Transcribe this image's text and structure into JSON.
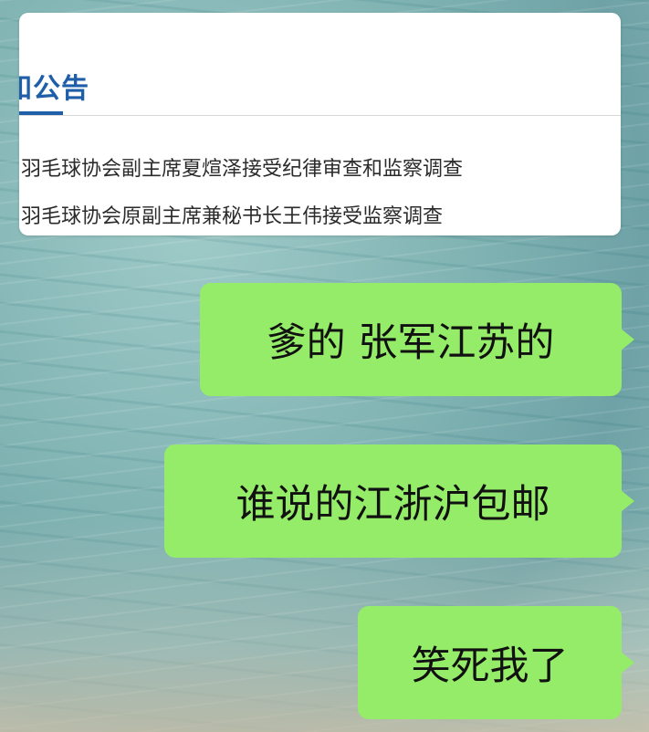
{
  "notice_card": {
    "title": "知公告",
    "items": [
      "羽毛球协会副主席夏煊泽接受纪律审查和监察调查",
      "羽毛球协会原副主席兼秘书长王伟接受监察调查"
    ]
  },
  "messages": [
    {
      "text": "爹的 张军江苏的",
      "sender": "me"
    },
    {
      "text": "谁说的江浙沪包邮",
      "sender": "me"
    },
    {
      "text": "笑死我了",
      "sender": "me"
    }
  ],
  "colors": {
    "bubble": "#95ec69",
    "title_blue": "#1f5ea8"
  }
}
